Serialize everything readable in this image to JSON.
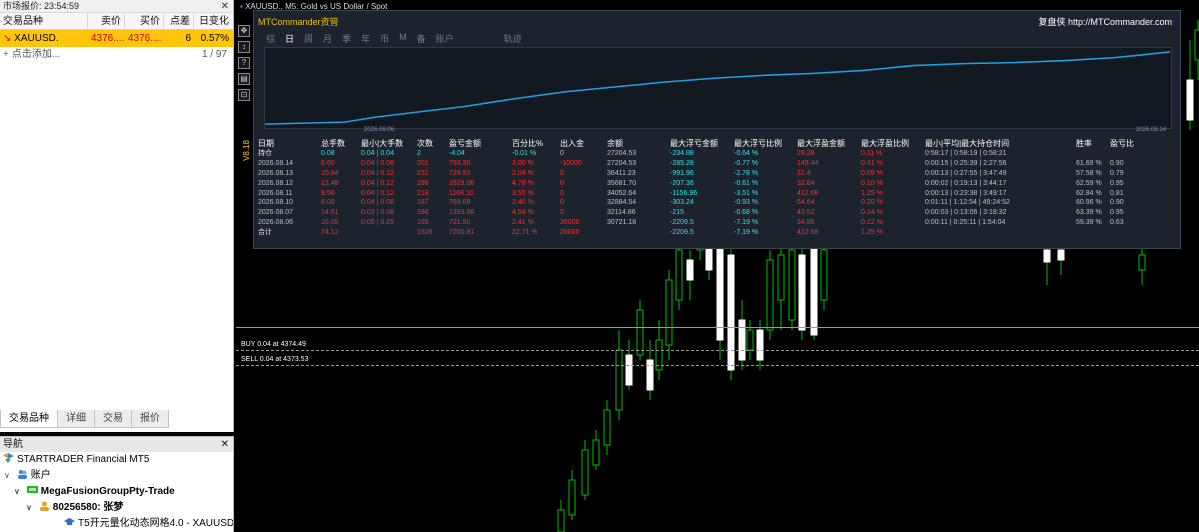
{
  "market_watch": {
    "title": "市场报价: 23:54:59",
    "headers": [
      "交易品种",
      "卖价",
      "买价",
      "点差",
      "日变化"
    ],
    "row": {
      "symbol": "XAUUSD.",
      "bid": "4376....",
      "ask": "4376....",
      "spread": "6",
      "change": "0.57%"
    },
    "add_label": "点击添加...",
    "count": "1 / 97",
    "tabs": [
      "交易品种",
      "详细",
      "交易",
      "报价"
    ]
  },
  "navigator": {
    "title": "导航",
    "broker": "STARTRADER Financial MT5",
    "accounts": "账户",
    "server": "MegaFusionGroupPty-Trade",
    "account": "80256580: 张梦",
    "ea": "T5开元量化动态网格4.0 - XAUUSD"
  },
  "chart": {
    "tag": "XAUUSD., M5: Gold vs US Dollar / Spot",
    "vertical_label": "V8.18",
    "buy_line": "BUY 0.04 at 4374.49",
    "sell_line": "SELL 0.04 at 4373.53",
    "tool_icons": [
      "✥",
      "↕",
      "?",
      "▤",
      "⊡"
    ]
  },
  "panel": {
    "title": "MTCommander资管",
    "link": "复盘侠 http://MTCommander.com",
    "tabs": [
      "综",
      "日",
      "周",
      "月",
      "季",
      "年",
      "币",
      "M",
      "备",
      "账户",
      "轨迹"
    ],
    "active_tab": "日",
    "date_start": "2026.08.06",
    "date_end": "2026.08.14",
    "headers": [
      "日期",
      "总手数",
      "最小|大手数",
      "次数",
      "盈亏金额",
      "百分比%",
      "出入金",
      "余额",
      "最大浮亏金额",
      "最大浮亏比例",
      "最大浮盈金额",
      "最大浮盈比例",
      "最小|平均|最大持仓时间",
      "胜率",
      "盈亏比"
    ],
    "rows": [
      [
        "持仓",
        "0.08",
        "0.04 | 0.04",
        "2",
        "-4.04",
        "-0.01 %",
        "0",
        "27204.53",
        "-234.88",
        "-0.64 %",
        "29.28",
        "0.11 %",
        "0:58:17 | 0:58:19 | 0:58:21",
        "",
        ""
      ],
      [
        "2026.08.14",
        "8.60",
        "0.04 | 0.08",
        "201",
        "793.30",
        "3.00 %",
        "-10000",
        "27204.53",
        "-285.28",
        "-0.77 %",
        "149.44",
        "0.41 %",
        "0:00:15 | 0:25:39 | 2:27:56",
        "61.69 %",
        "0.90"
      ],
      [
        "2026.08.13",
        "10.84",
        "0.04 | 0.12",
        "231",
        "729.53",
        "2.04 %",
        "0",
        "36411.23",
        "-991.96",
        "-2.78 %",
        "32.4",
        "0.09 %",
        "0:00:13 | 0:27:55 | 3:47:49",
        "57.58 %",
        "0.79"
      ],
      [
        "2026.08.12",
        "12.48",
        "0.04 | 0.12",
        "286",
        "1629.06",
        "4.78 %",
        "0",
        "35681.70",
        "-207.36",
        "-0.61 %",
        "32.84",
        "0.10 %",
        "0:00:02 | 0:19:13 | 3:44:17",
        "62.59 %",
        "0.95"
      ],
      [
        "2026.08.11",
        "9.56",
        "0.04 | 0.12",
        "218",
        "1168.10",
        "3.55 %",
        "0",
        "34052.64",
        "-1156.96",
        "-3.51 %",
        "412.68",
        "1.25 %",
        "0:00:13 | 0:23:38 | 3:49:17",
        "62.84 %",
        "0.81"
      ],
      [
        "2026.08.10",
        "8.00",
        "0.04 | 0.08",
        "187",
        "769.68",
        "2.40 %",
        "0",
        "32884.54",
        "-303.24",
        "-0.93 %",
        "64.64",
        "0.20 %",
        "0:01:11 | 1:12:54 | 49:24:52",
        "60.96 %",
        "0.90"
      ],
      [
        "2026.08.07",
        "14.61",
        "0.03 | 0.08",
        "336",
        "1393.68",
        "4.54 %",
        "0",
        "32114.86",
        "-215",
        "-0.68 %",
        "43.52",
        "0.14 %",
        "0:00:03 | 0:13:06 | 3:18:32",
        "63.39 %",
        "0.95"
      ],
      [
        "2026.08.06",
        "10.05",
        "0.05 | 0.25",
        "165",
        "721.50",
        "2.41 %",
        "30000",
        "30721.18",
        "-2209.5",
        "-7.19 %",
        "34.95",
        "0.12 %",
        "0:00:11 | 0:25:11 | 1:54:04",
        "59.39 %",
        "0.63"
      ],
      [
        "合计",
        "74.12",
        "",
        "1626",
        "7200.81",
        "22.71 %",
        "20000",
        "",
        "-2209.5",
        "-7.19 %",
        "412.68",
        "1.25 %",
        "",
        "",
        ""
      ]
    ]
  },
  "colors": {
    "accent": "#ffc40c",
    "equity_line": "#1ea0e6",
    "bull": "#00c000",
    "bear": "#ffffff"
  }
}
